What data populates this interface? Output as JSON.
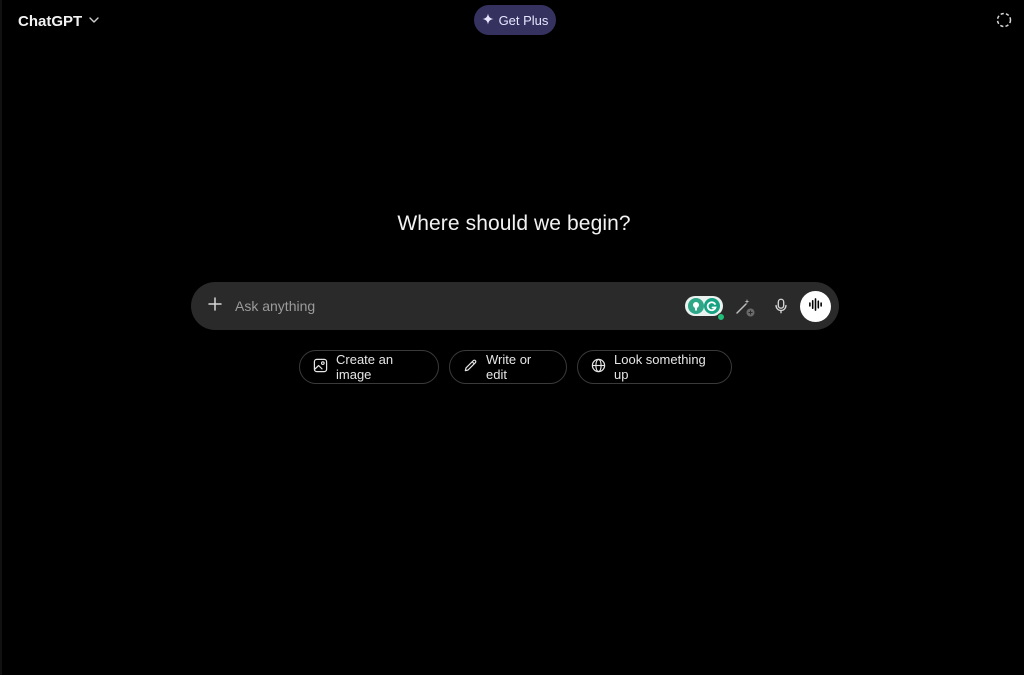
{
  "header": {
    "model_name": "ChatGPT",
    "get_plus_label": "Get Plus"
  },
  "main": {
    "heading": "Where should we begin?"
  },
  "composer": {
    "placeholder": "Ask anything"
  },
  "suggestions": [
    {
      "label": "Create an image",
      "icon": "image-icon"
    },
    {
      "label": "Write or edit",
      "icon": "pencil-icon"
    },
    {
      "label": "Look something up",
      "icon": "globe-icon"
    }
  ],
  "colors": {
    "background": "#000000",
    "composer": "#2a2a2a",
    "get_plus_bg": "#35325f",
    "grammarly": "#15c39a"
  }
}
